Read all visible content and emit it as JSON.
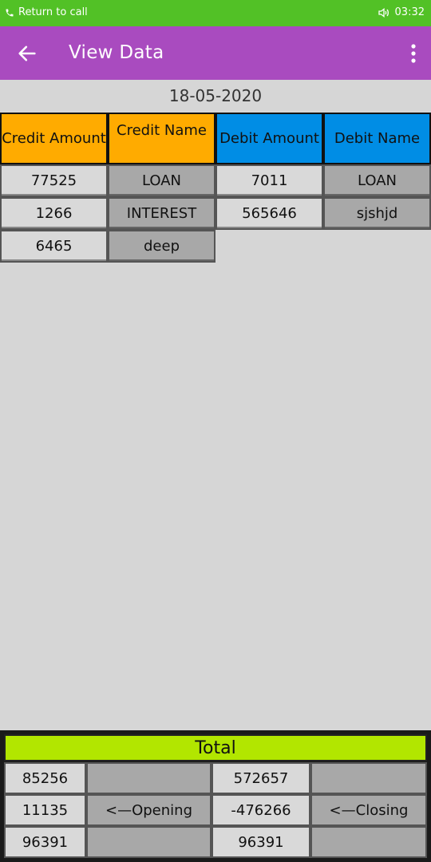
{
  "status_bar": {
    "call_text": "Return to call",
    "time": "03:32",
    "icons": [
      "phone-icon",
      "speaker-icon"
    ]
  },
  "app_bar": {
    "title": "View Data",
    "icons": [
      "back-arrow-icon",
      "more-vert-icon"
    ]
  },
  "date": "18-05-2020",
  "table": {
    "headers": [
      "Credit Amount",
      "Credit Name",
      "Debit Amount",
      "Debit Name"
    ],
    "rows": [
      [
        "77525",
        "LOAN",
        "7011",
        "LOAN"
      ],
      [
        "1266",
        "INTEREST",
        "565646",
        "sjshjd"
      ],
      [
        "6465",
        "deep",
        "",
        ""
      ]
    ]
  },
  "total": {
    "title": "Total",
    "rows": [
      [
        "85256",
        "",
        "572657",
        ""
      ],
      [
        "11135",
        "<—Opening",
        "-476266",
        "<—Closing"
      ],
      [
        "96391",
        "",
        "96391",
        ""
      ]
    ]
  },
  "colors": {
    "status_bar": "#52c126",
    "app_bar": "#a94bbf",
    "credit_header": "#ffab00",
    "debit_header": "#008de5",
    "total_header": "#b2e600"
  }
}
